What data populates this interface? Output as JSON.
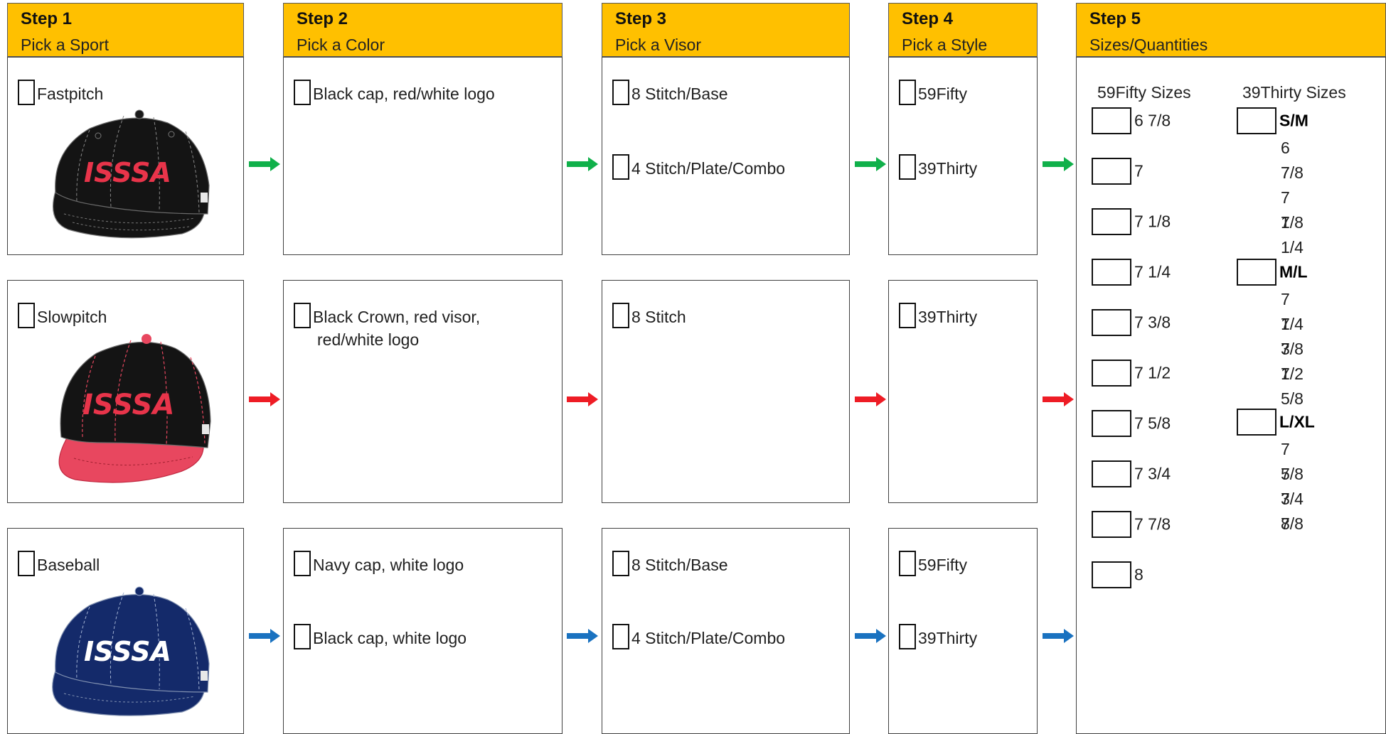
{
  "steps": [
    {
      "title": "Step 1",
      "subtitle": "Pick a Sport"
    },
    {
      "title": "Step 2",
      "subtitle": "Pick a Color"
    },
    {
      "title": "Step 3",
      "subtitle": "Pick a Visor"
    },
    {
      "title": "Step 4",
      "subtitle": "Pick a Style"
    },
    {
      "title": "Step 5",
      "subtitle": "Sizes/Quantities"
    }
  ],
  "rows": [
    {
      "sport": "Fastpitch",
      "logo_text": "ISSSA",
      "arrow_color": "#10b04a",
      "cap_colors": {
        "crown": "#151515",
        "visor": "#151515",
        "logo": "#e8344a"
      },
      "colors": [
        "Black cap, red/white logo"
      ],
      "visors": [
        "8 Stitch/Base",
        "4 Stitch/Plate/Combo"
      ],
      "styles": [
        "59Fifty",
        "39Thirty"
      ]
    },
    {
      "sport": "Slowpitch",
      "logo_text": "ISSSA",
      "arrow_color": "#ee1c25",
      "cap_colors": {
        "crown": "#151515",
        "visor": "#e8475f",
        "logo": "#e8344a"
      },
      "colors": [
        "Black Crown, red visor,",
        "red/white logo"
      ],
      "visors": [
        "8 Stitch"
      ],
      "styles": [
        "39Thirty"
      ]
    },
    {
      "sport": "Baseball",
      "logo_text": "ISSSA",
      "arrow_color": "#1a72c0",
      "cap_colors": {
        "crown": "#142a6a",
        "visor": "#142a6a",
        "logo": "#ffffff"
      },
      "colors": [
        "Navy cap, white logo",
        "Black cap, white logo"
      ],
      "visors": [
        "8 Stitch/Base",
        "4 Stitch/Plate/Combo"
      ],
      "styles": [
        "59Fifty",
        "39Thirty"
      ]
    }
  ],
  "sizes": {
    "fifty_heading": "59Fifty Sizes",
    "thirty_heading": "39Thirty Sizes",
    "fifty": [
      "6 7/8",
      "7",
      "7 1/8",
      "7 1/4",
      "7 3/8",
      "7 1/2",
      "7 5/8",
      "7 3/4",
      "7 7/8",
      "8"
    ],
    "thirty": [
      {
        "label": "S/M",
        "fits": [
          "6 7/8",
          "7",
          "7 1/8",
          "7 1/4"
        ]
      },
      {
        "label": "M/L",
        "fits": [
          "7 1/4",
          "7 3/8",
          "7 1/2",
          "7 5/8"
        ]
      },
      {
        "label": "L/XL",
        "fits": [
          "7 5/8",
          "7 3/4",
          "7 7/8",
          "8"
        ]
      }
    ]
  }
}
